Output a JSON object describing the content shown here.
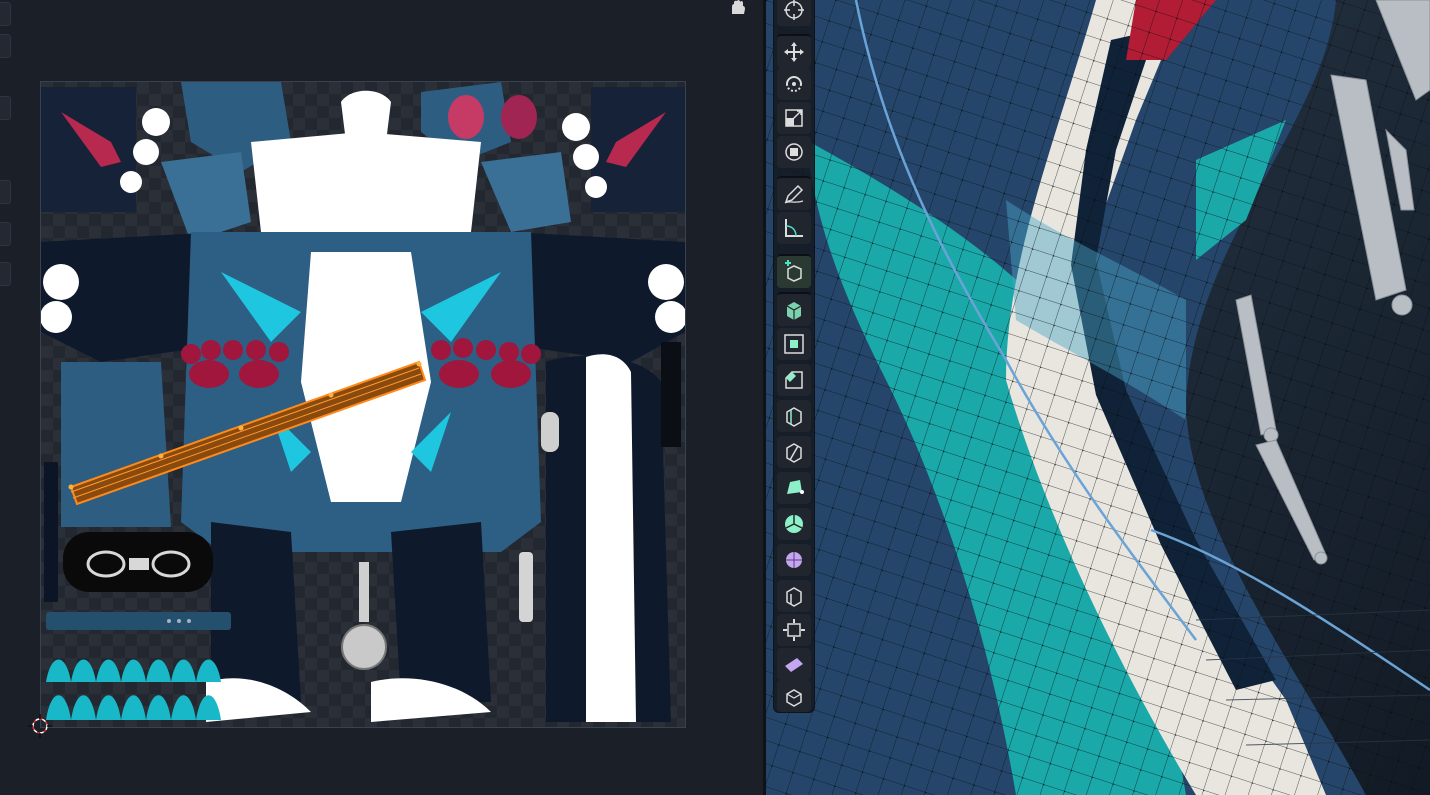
{
  "app": {
    "left_editor": "uv-image-editor",
    "right_editor": "3d-viewport"
  },
  "colors": {
    "background": "#1b1f27",
    "accent_teal": "#1fb3b3",
    "dark_blue": "#12243a",
    "mid_blue": "#2d5f84",
    "pink": "#c63a66",
    "orange": "#e07a12",
    "white": "#ffffff"
  },
  "uv_editor": {
    "sidebar_buttons": 6,
    "hand_icon": "hand-grab-icon",
    "cursor_icon": "2d-cursor-icon"
  },
  "toolbar": {
    "tools": [
      {
        "name": "cursor-tool",
        "icon": "crosshair-icon"
      },
      {
        "name": "move-tool",
        "icon": "move-arrows-icon"
      },
      {
        "name": "rotate-tool",
        "icon": "rotate-icon"
      },
      {
        "name": "scale-tool",
        "icon": "scale-icon"
      },
      {
        "name": "transform-tool",
        "icon": "transform-icon"
      },
      {
        "name": "annotate-tool",
        "icon": "pencil-icon"
      },
      {
        "name": "measure-tool",
        "icon": "ruler-angle-icon"
      },
      {
        "name": "add-cube-tool",
        "icon": "add-cube-icon"
      },
      {
        "name": "extrude-tool",
        "icon": "extrude-icon"
      },
      {
        "name": "inset-tool",
        "icon": "inset-faces-icon"
      },
      {
        "name": "bevel-tool",
        "icon": "bevel-icon"
      },
      {
        "name": "loop-cut-tool",
        "icon": "loop-cut-icon"
      },
      {
        "name": "knife-tool",
        "icon": "knife-icon"
      },
      {
        "name": "poly-build-tool",
        "icon": "poly-build-icon"
      },
      {
        "name": "spin-tool",
        "icon": "spin-icon"
      },
      {
        "name": "smooth-tool",
        "icon": "smooth-sphere-icon"
      },
      {
        "name": "edge-slide-tool",
        "icon": "edge-slide-icon"
      },
      {
        "name": "shrink-fatten-tool",
        "icon": "shrink-fatten-icon"
      },
      {
        "name": "shear-tool",
        "icon": "shear-icon"
      },
      {
        "name": "rip-region-tool",
        "icon": "rip-region-icon"
      }
    ]
  }
}
